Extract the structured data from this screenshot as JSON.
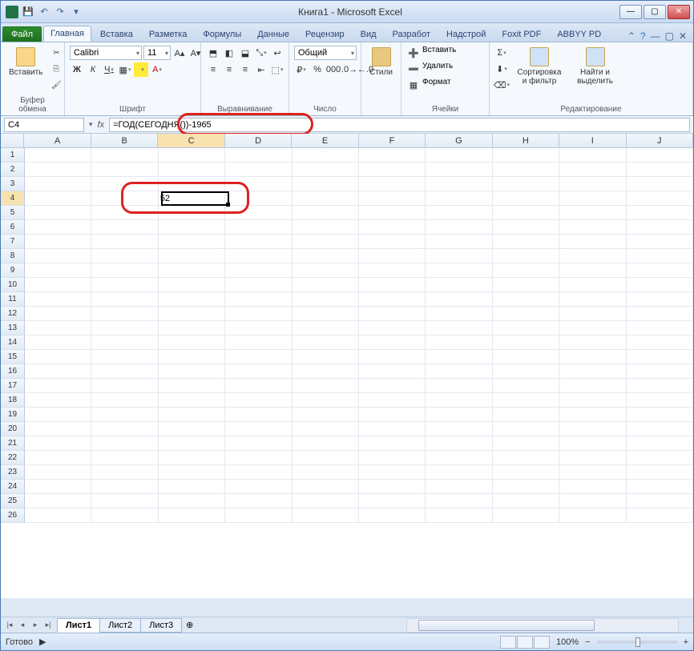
{
  "window": {
    "title": "Книга1 - Microsoft Excel"
  },
  "qat": {
    "save": "💾",
    "undo": "↶",
    "redo": "↷",
    "dd": "▾"
  },
  "winbtns": {
    "min": "—",
    "max": "▢",
    "close": "✕"
  },
  "tabs": {
    "file": "Файл",
    "items": [
      "Главная",
      "Вставка",
      "Разметка",
      "Формулы",
      "Данные",
      "Рецензир",
      "Вид",
      "Разработ",
      "Надстрой",
      "Foxit PDF",
      "ABBYY PD"
    ],
    "active_index": 0
  },
  "ribbon": {
    "clipboard": {
      "paste": "Вставить",
      "label": "Буфер обмена"
    },
    "font": {
      "name": "Calibri",
      "size": "11",
      "bold": "Ж",
      "italic": "К",
      "underline": "Ч",
      "label": "Шрифт"
    },
    "align": {
      "label": "Выравнивание"
    },
    "number": {
      "format": "Общий",
      "label": "Число"
    },
    "styles": {
      "btn": "Стили"
    },
    "cells": {
      "insert": "Вставить",
      "delete": "Удалить",
      "format": "Формат",
      "label": "Ячейки"
    },
    "editing": {
      "sort": "Сортировка и фильтр",
      "find": "Найти и выделить",
      "label": "Редактирование",
      "sum": "Σ"
    }
  },
  "formula_bar": {
    "cell_ref": "C4",
    "fx": "fx",
    "formula": "=ГОД(СЕГОДНЯ())-1965"
  },
  "grid": {
    "columns": [
      "A",
      "B",
      "C",
      "D",
      "E",
      "F",
      "G",
      "H",
      "I",
      "J"
    ],
    "rows": 26,
    "active_col": "C",
    "active_row": 4,
    "cell_value": "52"
  },
  "sheets": {
    "tabs": [
      "Лист1",
      "Лист2",
      "Лист3"
    ],
    "active": 0,
    "nav": [
      "|◂",
      "◂",
      "▸",
      "▸|"
    ]
  },
  "status": {
    "ready": "Готово",
    "zoom": "100%",
    "minus": "−",
    "plus": "+"
  }
}
